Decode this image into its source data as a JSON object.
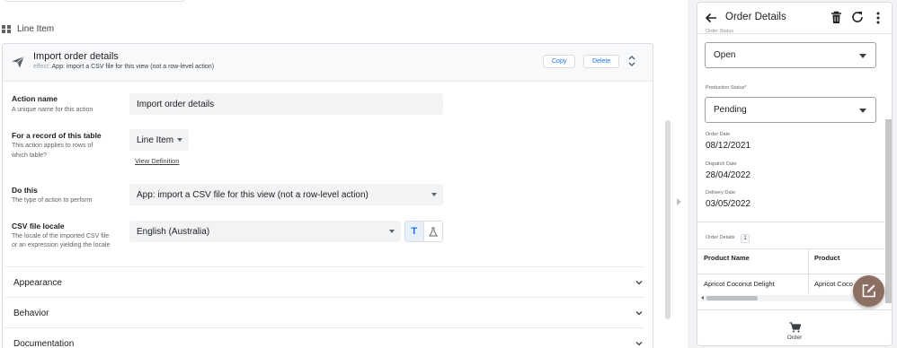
{
  "editor": {
    "section_title": "Line Item",
    "action": {
      "title": "Import order details",
      "effect_label": "effect:",
      "effect_text": "App: import a CSV file for this view (not a row-level action)",
      "copy_label": "Copy",
      "delete_label": "Delete"
    },
    "fields": {
      "action_name": {
        "label": "Action name",
        "help": "A unique name for this action",
        "value": "Import order details"
      },
      "record_table": {
        "label": "For a record of this table",
        "help_line1": "This action applies to rows of",
        "help_line2": "which table?",
        "value": "Line Item",
        "link": "View Definition"
      },
      "do_this": {
        "label": "Do this",
        "help": "The type of action to perform",
        "value": "App: import a CSV file for this view (not a row-level action)"
      },
      "csv_locale": {
        "label": "CSV file locale",
        "help_line1": "The locale of the imported CSV file",
        "help_line2": "or an expression yielding the locale",
        "value": "English (Australia)",
        "toggle_text": "T"
      }
    },
    "sections": [
      "Appearance",
      "Behavior",
      "Documentation"
    ]
  },
  "preview": {
    "title": "Order Details",
    "order_status_label": "Order Status",
    "order_status_value": "Open",
    "production_status_label": "Production Status*",
    "production_status_value": "Pending",
    "order_date_label": "Order Date",
    "order_date_value": "08/12/2021",
    "dispatch_date_label": "Dispatch Date",
    "dispatch_date_value": "28/04/2022",
    "delivery_date_label": "Delivery Date",
    "delivery_date_value": "03/05/2022",
    "order_details_label": "Order Details",
    "order_details_count": "1",
    "table": {
      "columns": [
        "Product Name",
        "Product"
      ],
      "rows": [
        [
          "Apricot Coconut Delight",
          "Apricot Coco"
        ]
      ]
    },
    "bottom_nav_label": "Order"
  },
  "colors": {
    "accent": "#1a73e8",
    "fab": "#8d6e63"
  },
  "icons": [
    "grid-icon",
    "send-icon",
    "unfold-icon",
    "back-arrow-icon",
    "trash-icon",
    "refresh-icon",
    "more-vert-icon",
    "edit-icon",
    "cart-icon",
    "chevron-down-icon",
    "flask-icon"
  ]
}
